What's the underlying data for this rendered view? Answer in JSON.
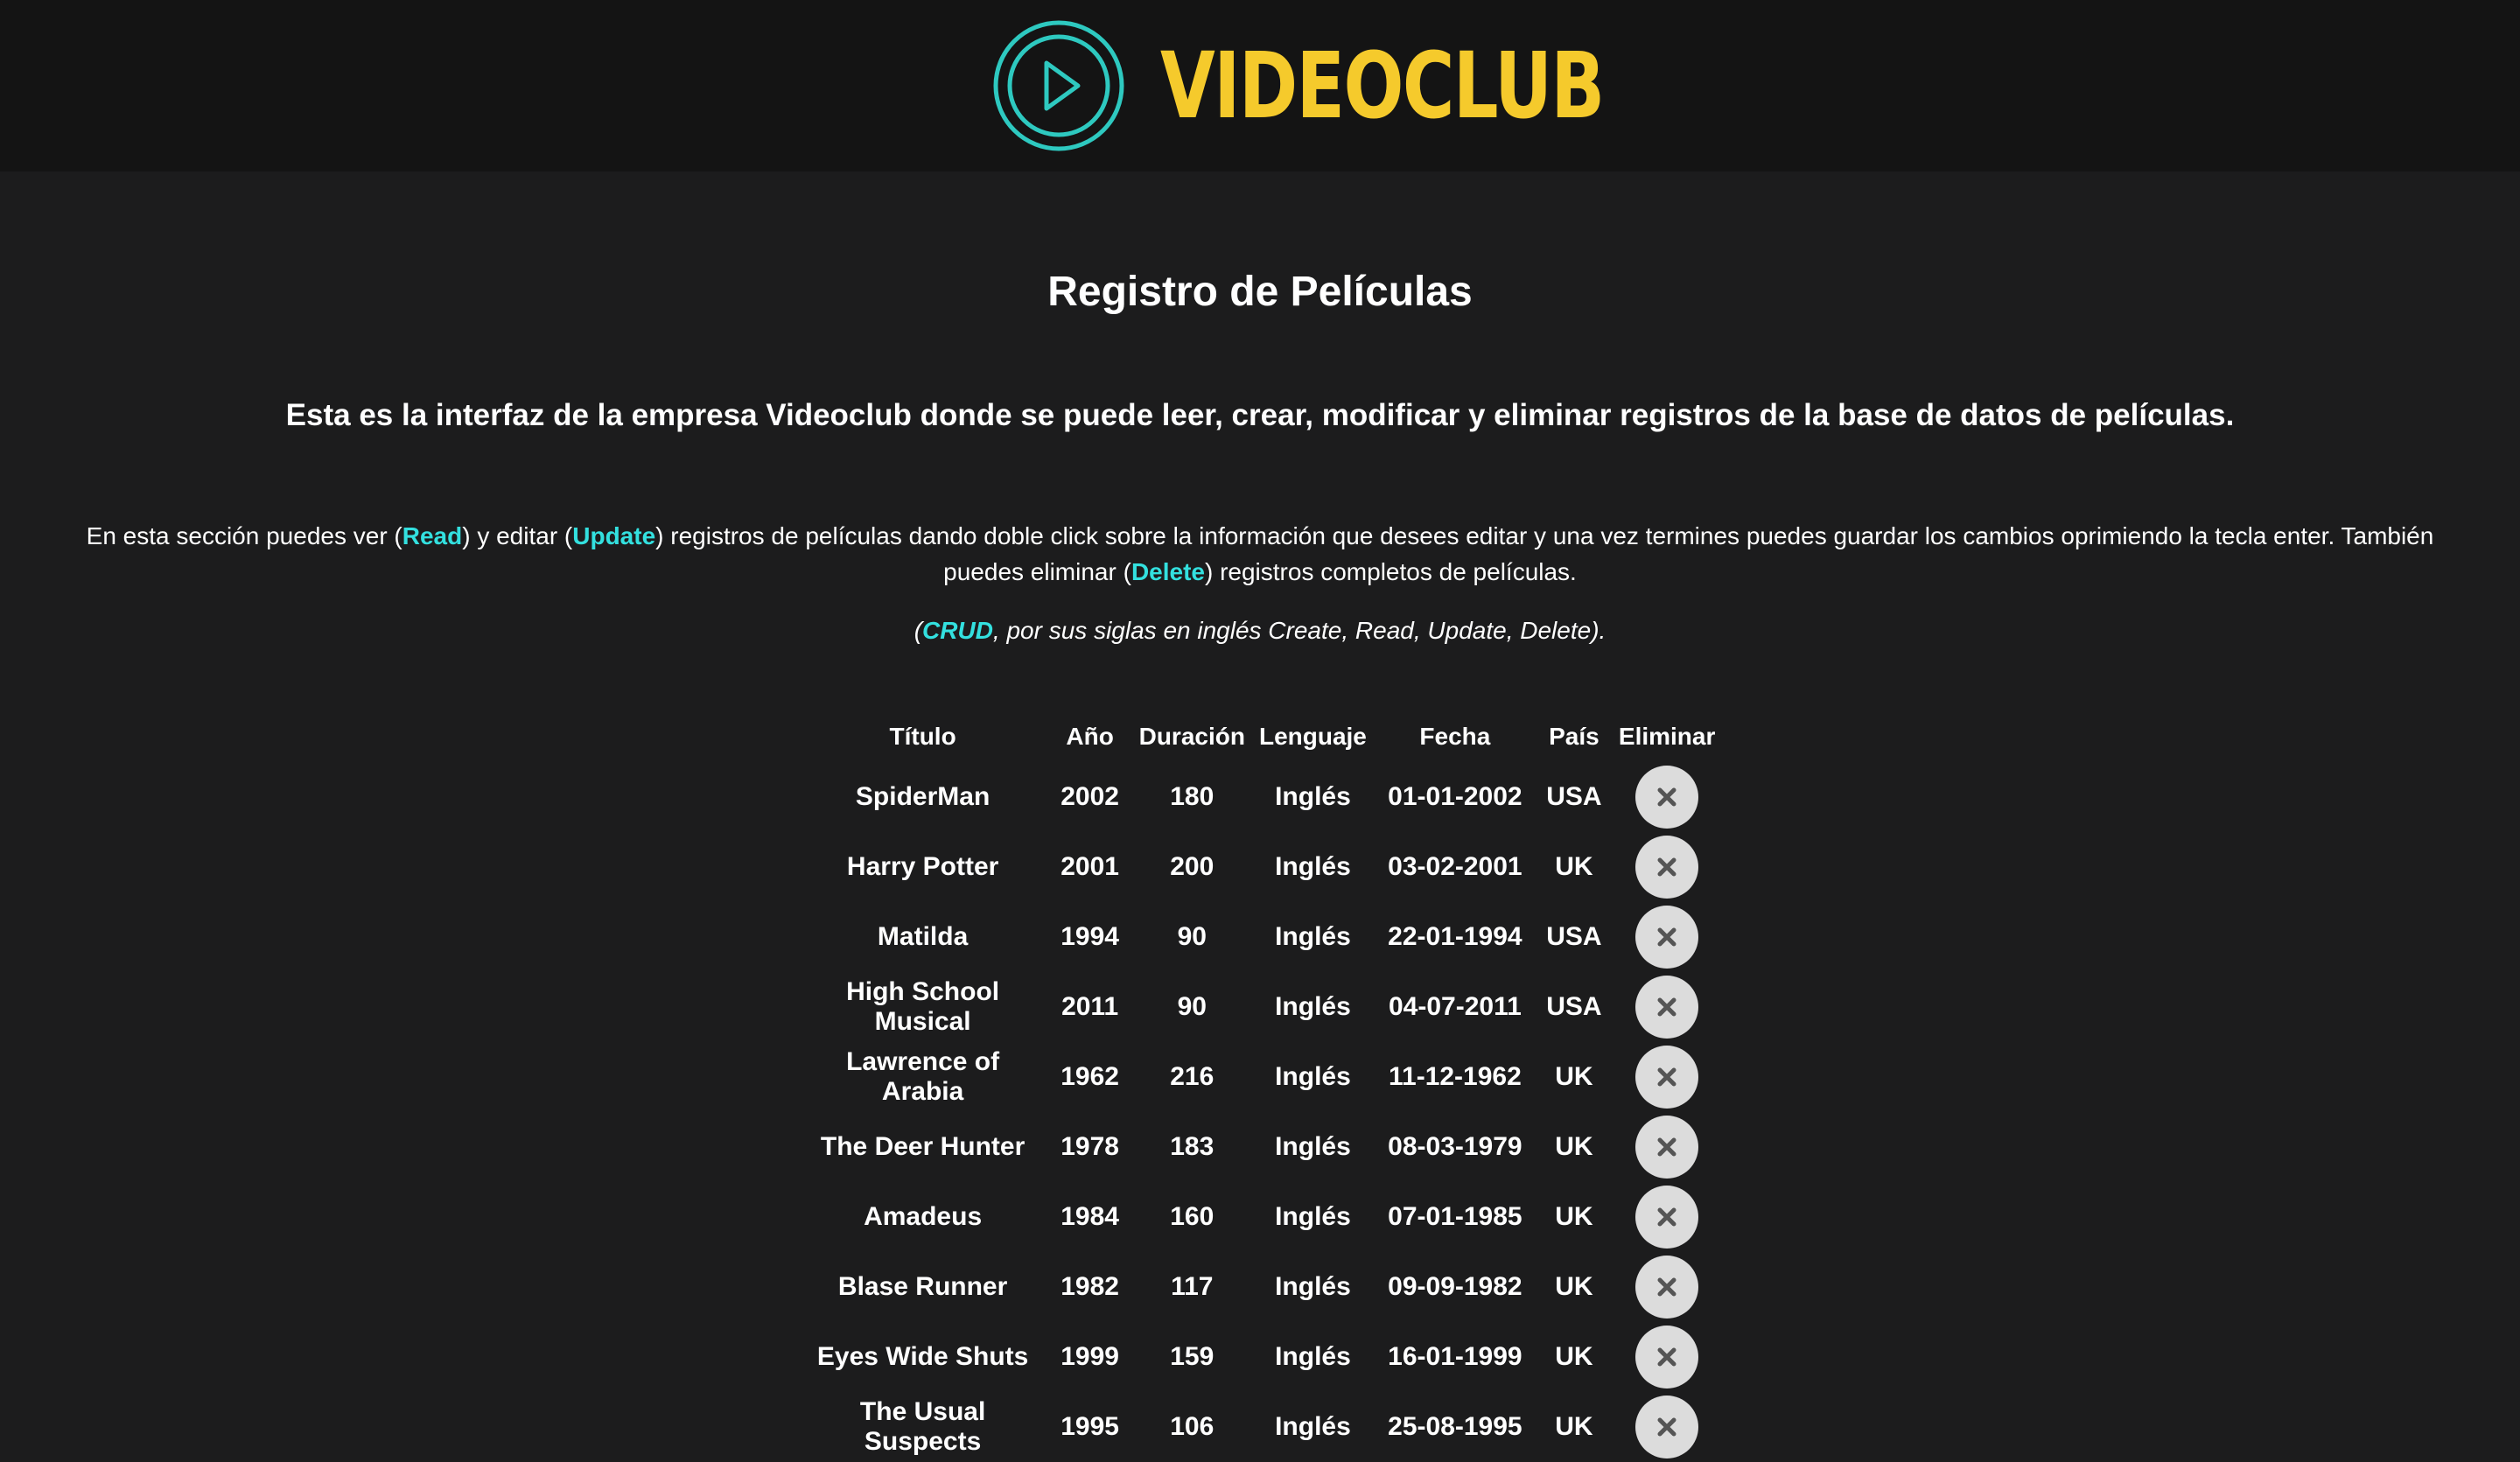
{
  "header": {
    "brand": "VIDEOCLUB",
    "logo_icon": "play-circle-icon",
    "colors": {
      "brand_text": "#f5ca2c",
      "logo": "#2ec9c0",
      "accent": "#33e0df",
      "background": "#1c1c1d",
      "header_bg": "#141414"
    }
  },
  "main": {
    "title": "Registro de Películas",
    "subtitle": "Esta es la interfaz de la empresa Videoclub donde se puede leer, crear, modificar y eliminar registros de la base de datos de películas.",
    "info": {
      "part1": "En esta sección puedes ver (",
      "read": "Read",
      "part2": ") y editar (",
      "update": "Update",
      "part3": ") registros de películas dando doble click sobre la información que desees editar y una vez termines puedes guardar los cambios oprimiendo la tecla enter. También puedes eliminar (",
      "delete": "Delete",
      "part4": ") registros completos de películas."
    },
    "crud_note": {
      "open": "(",
      "crud": "CRUD",
      "rest": ", por sus siglas en inglés Create, Read, Update, Delete)."
    }
  },
  "table": {
    "headers": [
      "Título",
      "Año",
      "Duración",
      "Lenguaje",
      "Fecha",
      "País",
      "Eliminar"
    ],
    "delete_icon": "close-icon",
    "rows": [
      [
        "SpiderMan",
        "2002",
        "180",
        "Inglés",
        "01-01-2002",
        "USA"
      ],
      [
        "Harry Potter",
        "2001",
        "200",
        "Inglés",
        "03-02-2001",
        "UK"
      ],
      [
        "Matilda",
        "1994",
        "90",
        "Inglés",
        "22-01-1994",
        "USA"
      ],
      [
        "High School Musical",
        "2011",
        "90",
        "Inglés",
        "04-07-2011",
        "USA"
      ],
      [
        "Lawrence of Arabia",
        "1962",
        "216",
        "Inglés",
        "11-12-1962",
        "UK"
      ],
      [
        "The Deer Hunter",
        "1978",
        "183",
        "Inglés",
        "08-03-1979",
        "UK"
      ],
      [
        "Amadeus",
        "1984",
        "160",
        "Inglés",
        "07-01-1985",
        "UK"
      ],
      [
        "Blase Runner",
        "1982",
        "117",
        "Inglés",
        "09-09-1982",
        "UK"
      ],
      [
        "Eyes Wide Shuts",
        "1999",
        "159",
        "Inglés",
        "16-01-1999",
        "UK"
      ],
      [
        "The Usual Suspects",
        "1995",
        "106",
        "Inglés",
        "25-08-1995",
        "UK"
      ]
    ]
  }
}
